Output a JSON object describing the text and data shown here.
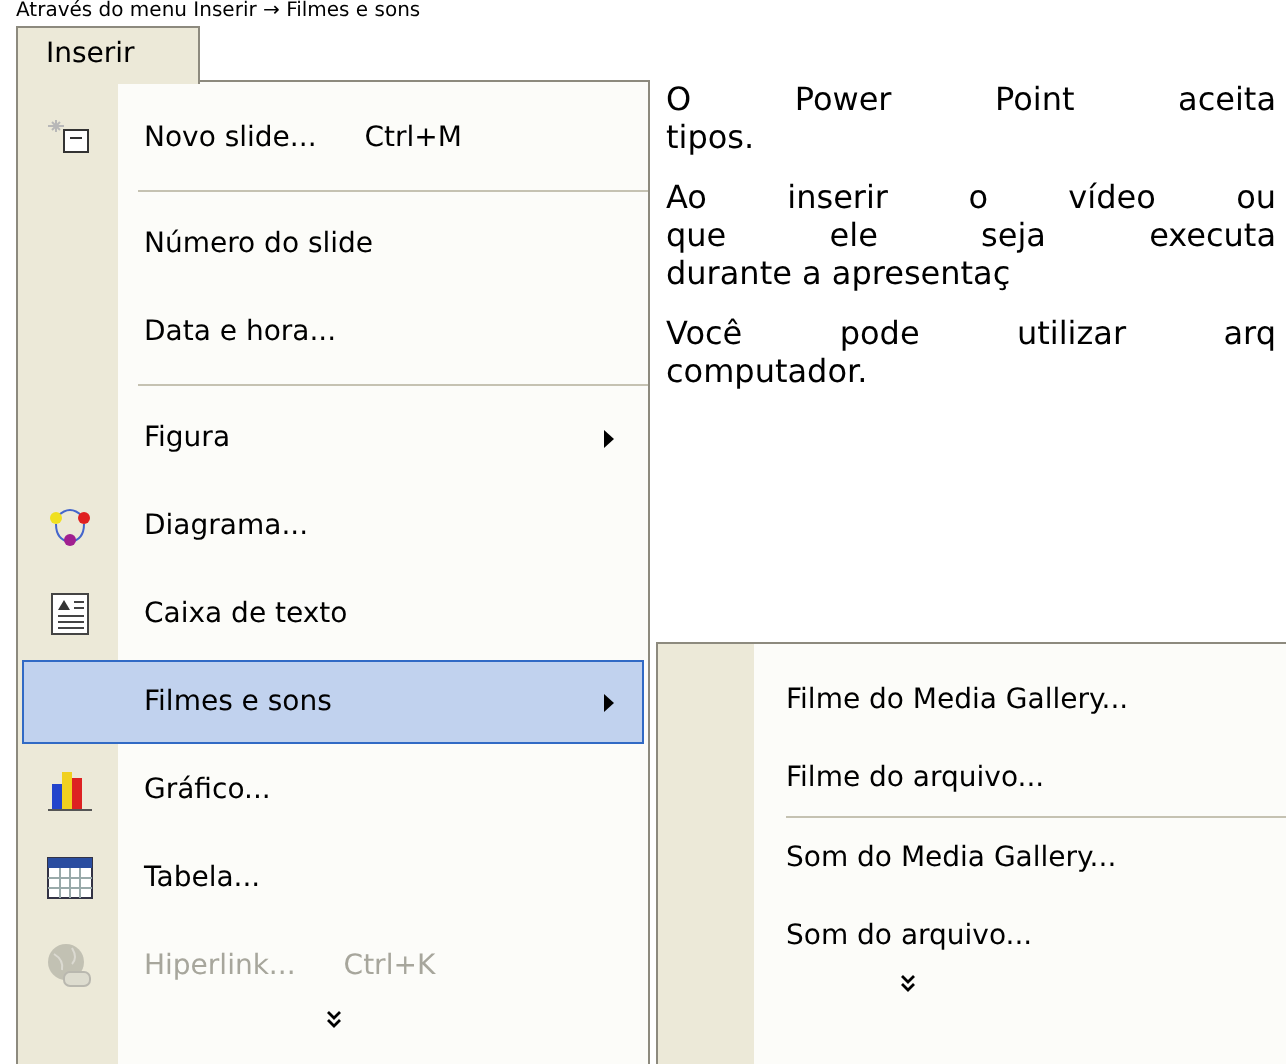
{
  "heading": "Através do menu Inserir → Filmes e sons",
  "menu_bar": {
    "label": "Inserir"
  },
  "menu": {
    "items": [
      {
        "kind": "item",
        "label": "Novo slide...",
        "shortcut": "Ctrl+M",
        "disabled": false,
        "selected": false
      },
      {
        "kind": "separator"
      },
      {
        "kind": "item",
        "label": "Número do slide",
        "disabled": false,
        "selected": false
      },
      {
        "kind": "item",
        "label": "Data e hora...",
        "disabled": false,
        "selected": false
      },
      {
        "kind": "separator"
      },
      {
        "kind": "submenu",
        "label": "Figura",
        "disabled": false,
        "selected": false
      },
      {
        "kind": "item",
        "label": "Diagrama...",
        "disabled": false,
        "selected": false
      },
      {
        "kind": "item",
        "label": "Caixa de texto",
        "disabled": false,
        "selected": false
      },
      {
        "kind": "submenu",
        "label": "Filmes e sons",
        "disabled": false,
        "selected": true
      },
      {
        "kind": "item",
        "label": "Gráfico...",
        "disabled": false,
        "selected": false
      },
      {
        "kind": "item",
        "label": "Tabela...",
        "disabled": false,
        "selected": false
      },
      {
        "kind": "item",
        "label": "Hiperlink...",
        "shortcut": "Ctrl+K",
        "disabled": true,
        "selected": false
      },
      {
        "kind": "more"
      }
    ]
  },
  "paragraphs": [
    {
      "lines": [
        "O Power Point aceita",
        "tipos."
      ]
    },
    {
      "lines": [
        "Ao inserir o vídeo ou",
        "que ele seja executa",
        "durante a apresentaç"
      ]
    },
    {
      "lines": [
        "Você pode utilizar arq",
        "computador."
      ]
    }
  ],
  "submenu": {
    "items": [
      {
        "kind": "item",
        "label": "Filme do Media Gallery..."
      },
      {
        "kind": "item",
        "label": "Filme do arquivo..."
      },
      {
        "kind": "separator"
      },
      {
        "kind": "item",
        "label": "Som do Media Gallery..."
      },
      {
        "kind": "item",
        "label": "Som do arquivo..."
      },
      {
        "kind": "more"
      }
    ]
  }
}
